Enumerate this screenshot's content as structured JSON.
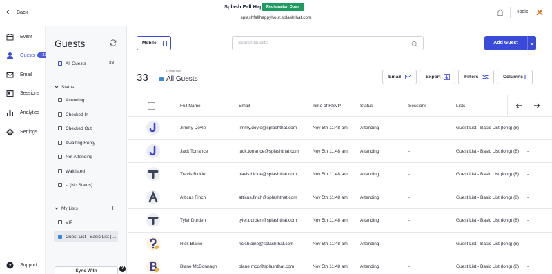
{
  "topbar": {
    "back_label": "Back",
    "event_title": "Splash Fall Happy Hour",
    "registration_badge": "Registration Open",
    "event_url": "splashfallhappyhour.splashthat.com",
    "tools_label": "Tools"
  },
  "leftnav": {
    "items": [
      {
        "label": "Event",
        "icon": "calendar-icon"
      },
      {
        "label": "Guests",
        "icon": "person-icon",
        "badge": "+33"
      },
      {
        "label": "Email",
        "icon": "envelope-icon"
      },
      {
        "label": "Sessions",
        "icon": "sessions-icon"
      },
      {
        "label": "Analytics",
        "icon": "bar-chart-icon"
      },
      {
        "label": "Settings",
        "icon": "gear-icon"
      }
    ],
    "support_label": "Support"
  },
  "guest_panel": {
    "title": "Guests",
    "all_guests_label": "All Guests",
    "all_guests_count": "33",
    "status_heading": "Status",
    "status_filters": [
      "Attending",
      "Checked In",
      "Checked Out",
      "Awaiting Reply",
      "Not Attending",
      "Waitlisted",
      "-- (No Status)"
    ],
    "lists_heading": "My Lists",
    "lists": [
      "VIP",
      "Guest List - Basic List (l..."
    ],
    "sync_label": "Sync With"
  },
  "toolbar": {
    "mobile_label": "Mobile",
    "search_placeholder": "Search Guests",
    "add_guest_label": "Add Guest"
  },
  "view": {
    "count": "33",
    "viewing_label": "VIEWING",
    "name": "All Guests",
    "email_btn": "Email",
    "export_btn": "Export",
    "filters_btn": "Filters",
    "columns_btn": "Columns"
  },
  "table": {
    "headers": [
      "Full Name",
      "Email",
      "Time of RSVP",
      "Status",
      "Sessions",
      "Lists"
    ],
    "rows": [
      {
        "name": "Jimmy Doyle",
        "email": "jimmy.doyle@splashthat.com",
        "rsvp": "Nov 5th 11:48 am",
        "status": "Attending",
        "sessions": "-",
        "lists": "Guest List - Basic List (long) (8)",
        "extra": "-",
        "avatar": "letter-j"
      },
      {
        "name": "Jack Torrance",
        "email": "jack.torrance@splashthat.com",
        "rsvp": "Nov 5th 11:48 am",
        "status": "Attending",
        "sessions": "-",
        "lists": "Guest List - Basic List (long) (8)",
        "extra": "-",
        "avatar": "letter-j"
      },
      {
        "name": "Travis Bickle",
        "email": "travis.bickle@splashthat.com",
        "rsvp": "Nov 5th 11:48 am",
        "status": "Attending",
        "sessions": "-",
        "lists": "Guest List - Basic List (long) (8)",
        "extra": "-",
        "avatar": "letter-t"
      },
      {
        "name": "Atticus Finch",
        "email": "atticus.finch@splashthat.com",
        "rsvp": "Nov 5th 11:48 am",
        "status": "Attending",
        "sessions": "-",
        "lists": "Guest List - Basic List (long) (8)",
        "extra": "-",
        "avatar": "letter-a"
      },
      {
        "name": "Tyler Durden",
        "email": "tyler.durden@splashthat.com",
        "rsvp": "Nov 5th 11:48 am",
        "status": "Attending",
        "sessions": "-",
        "lists": "Guest List - Basic List (long) (8)",
        "extra": "-",
        "avatar": "letter-t"
      },
      {
        "name": "Rick Blaine",
        "email": "rick.blaine@splashthat.com",
        "rsvp": "Nov 5th 11:48 am",
        "status": "Attending",
        "sessions": "-",
        "lists": "Guest List - Basic List (long) (8)",
        "extra": "-",
        "avatar": "question"
      },
      {
        "name": "Blane McDonnagh",
        "email": "blane.mcd@splashthat.com",
        "rsvp": "Nov 5th 11:48 am",
        "status": "Attending",
        "sessions": "-",
        "lists": "Guest List - Basic List (long) (8)",
        "extra": "-",
        "avatar": "letter-b"
      }
    ]
  },
  "colors": {
    "accent": "#3a4bd9",
    "success": "#1d9b63",
    "list_dot": "#3a8ad9"
  }
}
